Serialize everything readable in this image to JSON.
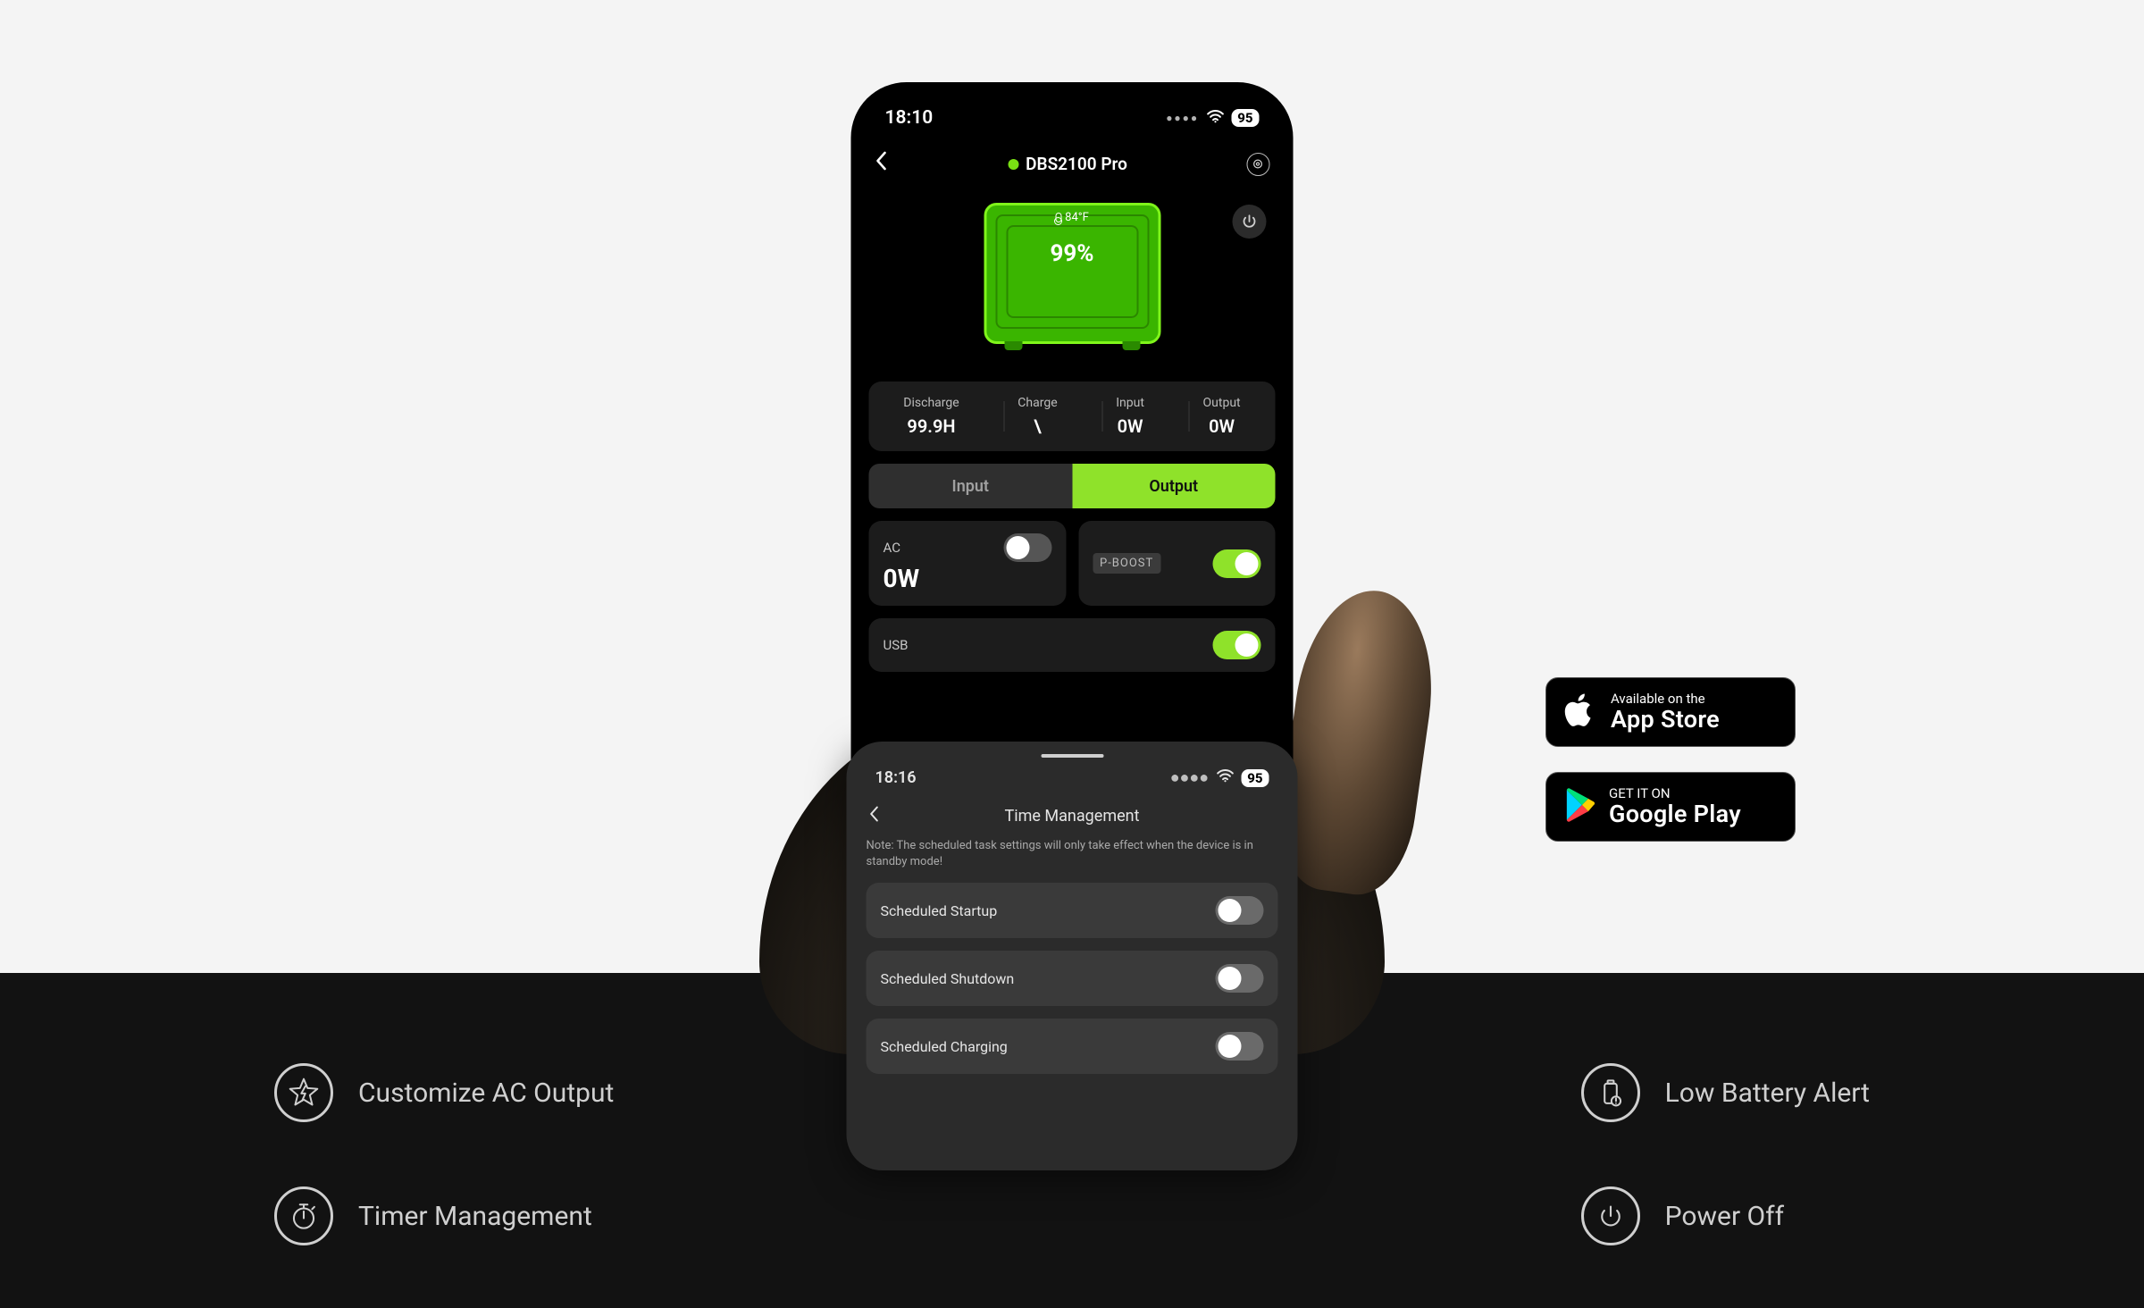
{
  "statusbar": {
    "time": "18:10",
    "battery_badge": "95"
  },
  "header": {
    "device_name": "DBS2100 Pro"
  },
  "device": {
    "temperature": "84°F",
    "soc": "99%"
  },
  "stats": {
    "discharge_label": "Discharge",
    "discharge_value": "99.9H",
    "charge_label": "Charge",
    "charge_value": "\\",
    "input_label": "Input",
    "input_value": "0W",
    "output_label": "Output",
    "output_value": "0W"
  },
  "segmented": {
    "input": "Input",
    "output": "Output"
  },
  "ac": {
    "label": "AC",
    "value": "0W"
  },
  "pboost": {
    "label": "P-BOOST"
  },
  "usb": {
    "label": "USB"
  },
  "sheet": {
    "time": "18:16",
    "battery_badge": "95",
    "title": "Time Management",
    "note": "Note: The scheduled task settings will only take effect when the device is in standby mode!",
    "item1": "Scheduled Startup",
    "item2": "Scheduled Shutdown",
    "item3": "Scheduled Charging"
  },
  "store": {
    "appstore_small": "Available on the",
    "appstore_big": "App Store",
    "play_small": "GET IT ON",
    "play_big": "Google Play"
  },
  "features": {
    "custom_ac": "Customize AC Output",
    "timer": "Timer Management",
    "low_batt": "Low Battery Alert",
    "power_off": "Power Off"
  }
}
